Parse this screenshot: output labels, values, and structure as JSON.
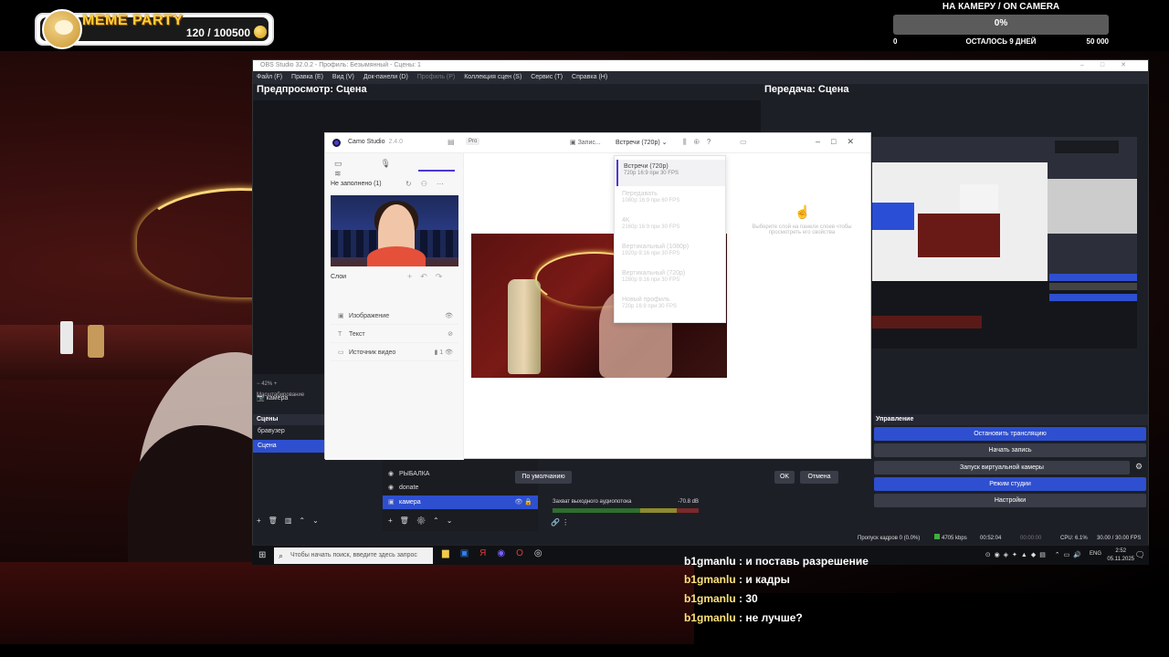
{
  "meme_badge": {
    "title": "MEME PARTY",
    "count": "120 / 100500"
  },
  "goal": {
    "title": "НА КАМЕРУ / ON CAMERA",
    "percent": "0%",
    "start": "0",
    "remaining": "ОСТАЛОСЬ 9 ДНЕЙ",
    "target": "50 000"
  },
  "obs": {
    "title": "OBS Studio 32.0.2 - Профиль: Безымянный - Сцены: 1",
    "menu": [
      "Файл (F)",
      "Правка (E)",
      "Вид (V)",
      "Док-панели (D)",
      "Профиль (P)",
      "Коллекция сцен (S)",
      "Сервис (T)",
      "Справка (H)"
    ],
    "preview_title": "Предпросмотр: Сцена",
    "program_title": "Передача: Сцена",
    "zoom": "42%",
    "zoom_label": "Масштабирование",
    "camera_source": "камера",
    "scenes_title": "Сцены",
    "scenes": [
      "бравузер",
      "Сцена"
    ],
    "sources": [
      {
        "label": "ment"
      },
      {
        "label": "РЫБАЛКА"
      },
      {
        "label": "donate"
      },
      {
        "label": "камера"
      }
    ],
    "mixer": {
      "label": "Захват выходного аудиопотока",
      "db": "-70.8 dB"
    },
    "controls_title": "Управление",
    "controls": [
      "Остановить трансляцию",
      "Начать запись",
      "Запуск виртуальной камеры",
      "Режим студии",
      "Настройки"
    ],
    "buttons": {
      "default": "По умолчанию",
      "ok": "OK",
      "cancel": "Отмена"
    },
    "status": {
      "dropped": "Пропуск кадров 0 (0.0%)",
      "kbps": "4705 kbps",
      "stream_time": "00:52:04",
      "rec_time": "00:00:00",
      "cpu": "CPU: 6.1%",
      "fps": "30.00 / 30.00 FPS"
    }
  },
  "camo": {
    "app_name": "Camo Studio",
    "version": "2.4.0",
    "pro": "Pro",
    "record": "Запис...",
    "mode": "Встречи (720p)",
    "unfilled": "Не заполнено (1)",
    "layers_title": "Слои",
    "layers": [
      {
        "label": "Изображение"
      },
      {
        "label": "Текст"
      },
      {
        "label": "Источник видео",
        "count": "1"
      }
    ],
    "options": [
      {
        "name": "Встречи (720p)",
        "spec": "720p 16:9 при 30 FPS"
      },
      {
        "name": "Передавать",
        "spec": "1080p 16:9 при 60 FPS"
      },
      {
        "name": "4K",
        "spec": "2160p 16:9 при 30 FPS"
      },
      {
        "name": "Вертикальный (1080p)",
        "spec": "1920p 9:16 при 30 FPS"
      },
      {
        "name": "Вертикальный (720p)",
        "spec": "1280p 9:16 при 30 FPS"
      },
      {
        "name": "Новый профиль",
        "spec": "720p 16:9 при 30 FPS"
      }
    ],
    "right_hint": "Выберите слой на панели слоев чтобы просмотреть его свойства"
  },
  "taskbar": {
    "search_placeholder": "Чтобы начать поиск, введите здесь запрос",
    "lang": "ENG",
    "time": "2:52",
    "date": "05.11.2025"
  },
  "chat": [
    {
      "user": "b1gmanlu",
      "text": "и кадры"
    },
    {
      "user": "b1gmanlu",
      "text": "30"
    },
    {
      "user": "b1gmanlu",
      "text": "не лучше?"
    }
  ],
  "chat_cut_line": "b1gmanlu : и поставь разрешение"
}
